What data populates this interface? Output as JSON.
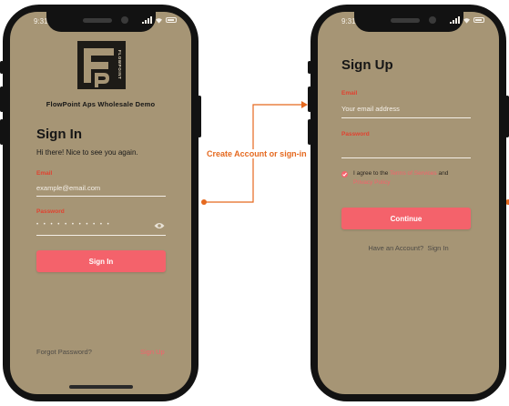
{
  "status": {
    "time": "9:31"
  },
  "brand": {
    "logo_text": "FLOWPOINT",
    "name": "FlowPoint Aps Wholesale Demo"
  },
  "signin": {
    "title": "Sign In",
    "greeting": "Hi there! Nice to see you again.",
    "email_label": "Email",
    "email_value": "example@email.com",
    "password_label": "Password",
    "password_value": "• • • • • • • • • • •",
    "button_label": "Sign In",
    "forgot_label": "Forgot Password?",
    "signup_link": "Sign Up"
  },
  "connector": {
    "label": "Create Account or sign-in"
  },
  "signup": {
    "title": "Sign Up",
    "email_label": "Email",
    "email_placeholder": "Your email address",
    "password_label": "Password",
    "agree_prefix": "I agree to the",
    "terms_label": "Terms of Services",
    "agree_and": "and",
    "privacy_label": "Privacy Policy",
    "agreed": true,
    "button_label": "Continue",
    "have_account": "Have an Account?",
    "signin_link": "Sign In"
  },
  "colors": {
    "screen_bg": "#a69575",
    "accent": "#f4626b",
    "label_red": "#e2412f",
    "connector": "#e5691f",
    "frame": "#121212"
  }
}
